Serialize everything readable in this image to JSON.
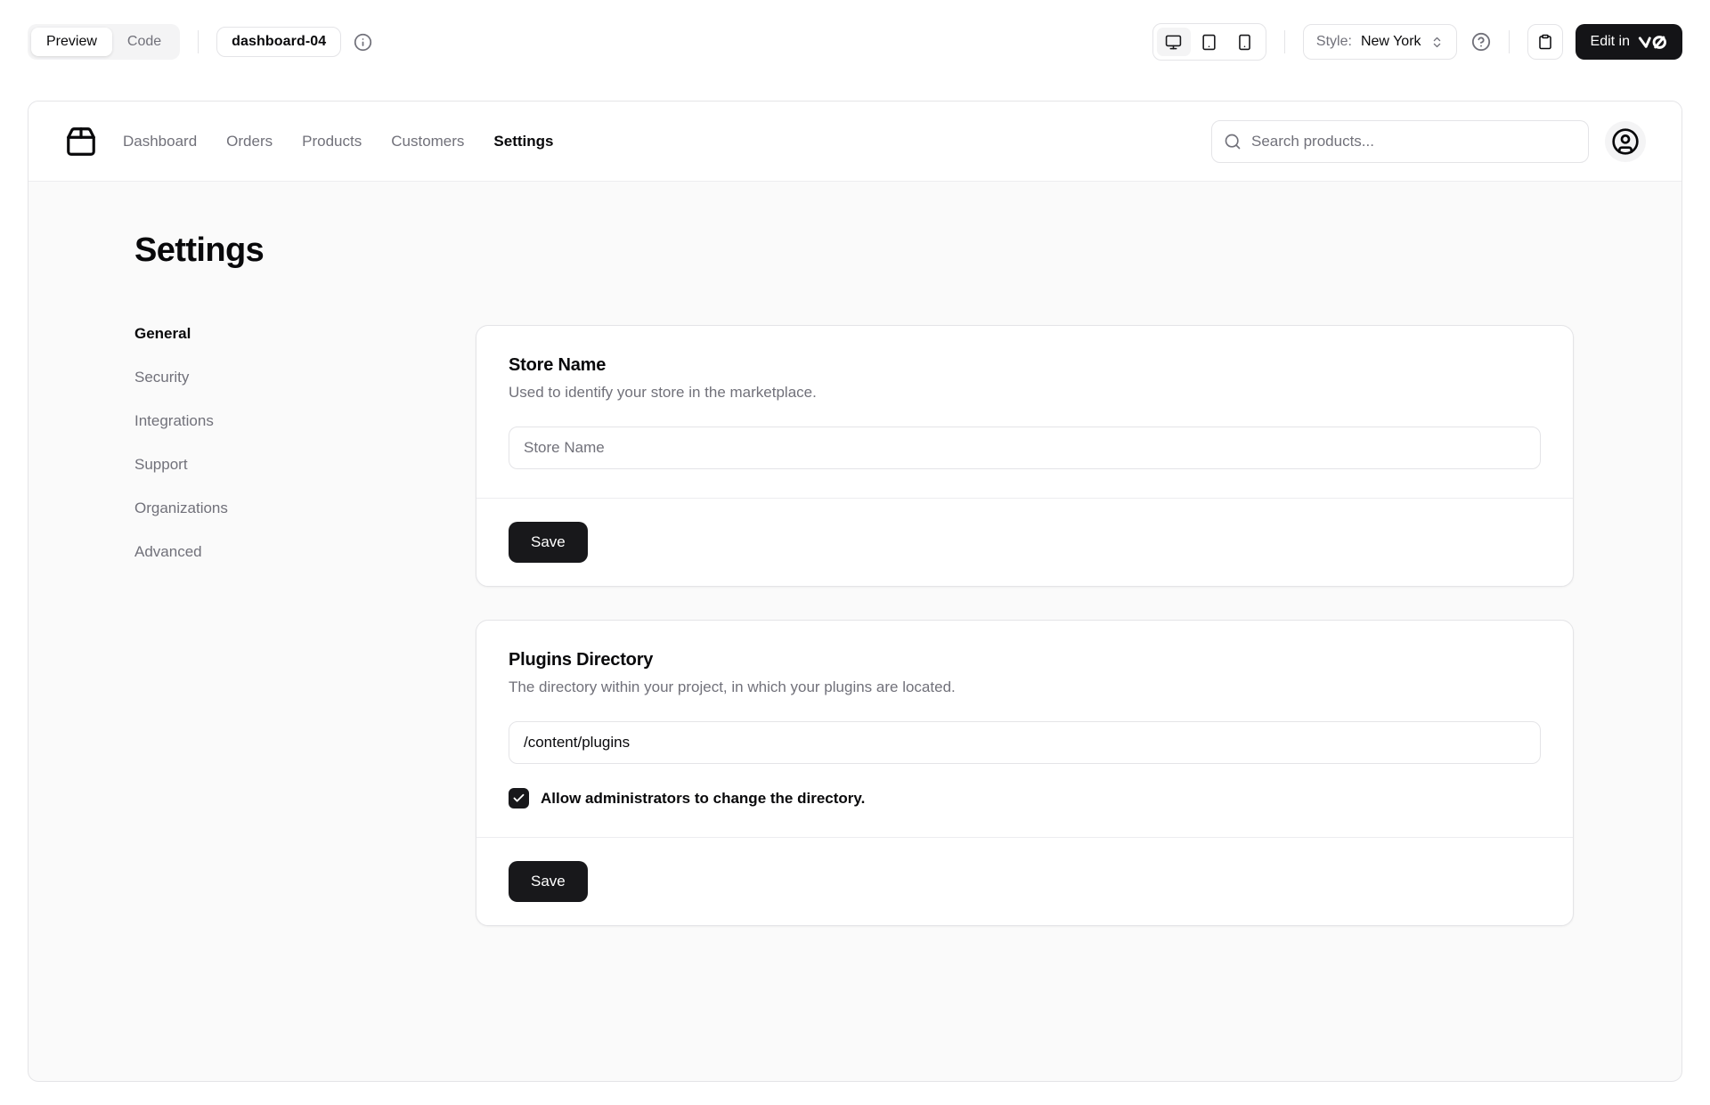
{
  "toolbar": {
    "tabs": {
      "preview": "Preview",
      "code": "Code"
    },
    "block_name": "dashboard-04",
    "style_label": "Style:",
    "style_value": "New York",
    "edit_button_label": "Edit in"
  },
  "nav": {
    "items": [
      {
        "label": "Dashboard",
        "active": false
      },
      {
        "label": "Orders",
        "active": false
      },
      {
        "label": "Products",
        "active": false
      },
      {
        "label": "Customers",
        "active": false
      },
      {
        "label": "Settings",
        "active": true
      }
    ],
    "search_placeholder": "Search products..."
  },
  "page": {
    "title": "Settings",
    "sidebar": [
      "General",
      "Security",
      "Integrations",
      "Support",
      "Organizations",
      "Advanced"
    ],
    "cards": [
      {
        "title": "Store Name",
        "description": "Used to identify your store in the marketplace.",
        "input_placeholder": "Store Name",
        "save_label": "Save"
      },
      {
        "title": "Plugins Directory",
        "description": "The directory within your project, in which your plugins are located.",
        "input_value": "/content/plugins",
        "checkbox_label": "Allow administrators to change the directory.",
        "checkbox_checked": true,
        "save_label": "Save"
      }
    ]
  },
  "colors": {
    "primary": "#18181b",
    "muted_text": "#71717a",
    "border": "#e4e4e7",
    "content_bg": "#fafafa",
    "toggle_bg": "#f4f4f5"
  }
}
